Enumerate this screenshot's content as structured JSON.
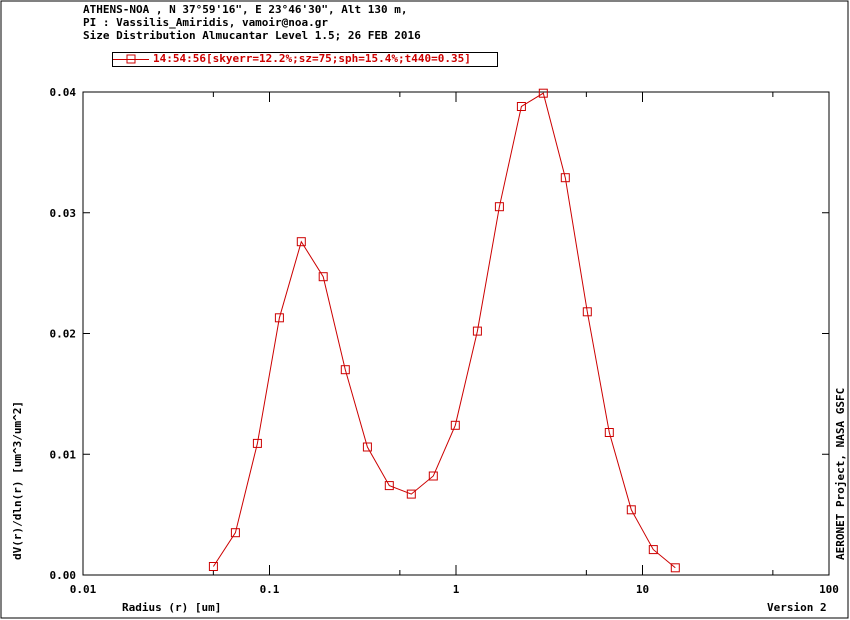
{
  "header": {
    "line1": "ATHENS-NOA , N 37°59'16\", E 23°46'30\", Alt 130 m,",
    "line2": "PI : Vassilis_Amiridis, vamoir@noa.gr",
    "line3": "Size Distribution Almucantar Level 1.5; 26 FEB 2016"
  },
  "footer": {
    "credit": "AERONET Project, NASA GSFC",
    "version": "Version 2"
  },
  "colors": {
    "series": "#cc0000",
    "axis": "#000000",
    "background": "#ffffff"
  },
  "chart_data": {
    "type": "line",
    "xscale": "log",
    "xlabel": "Radius (r) [um]",
    "ylabel": "dV(r)/dln(r) [um^3/um^2]",
    "xlim": [
      0.01,
      100
    ],
    "ylim": [
      0,
      0.04
    ],
    "xticks": [
      0.01,
      0.1,
      1,
      10,
      100
    ],
    "xtick_labels": [
      "0.01",
      "0.1",
      "1",
      "10",
      "100"
    ],
    "yticks": [
      0,
      0.01,
      0.02,
      0.03,
      0.04
    ],
    "ytick_labels": [
      "0.00",
      "0.01",
      "0.02",
      "0.03",
      "0.04"
    ],
    "grid": false,
    "legend_position": "top-left",
    "series": [
      {
        "name": "14:54:56[skyerr=12.2%;sz=75;sph=15.4%;t440=0.35]",
        "x": [
          0.05,
          0.0656,
          0.0861,
          0.113,
          0.148,
          0.194,
          0.255,
          0.335,
          0.439,
          0.576,
          0.756,
          0.992,
          1.302,
          1.708,
          2.241,
          2.94,
          3.857,
          5.06,
          6.638,
          8.709,
          11.426,
          15.0
        ],
        "y": [
          0.0007,
          0.0035,
          0.0109,
          0.0213,
          0.0276,
          0.0247,
          0.017,
          0.0106,
          0.0074,
          0.0067,
          0.0082,
          0.0124,
          0.0202,
          0.0305,
          0.0388,
          0.0399,
          0.0329,
          0.0218,
          0.0118,
          0.0054,
          0.0021,
          0.0006
        ]
      }
    ]
  }
}
